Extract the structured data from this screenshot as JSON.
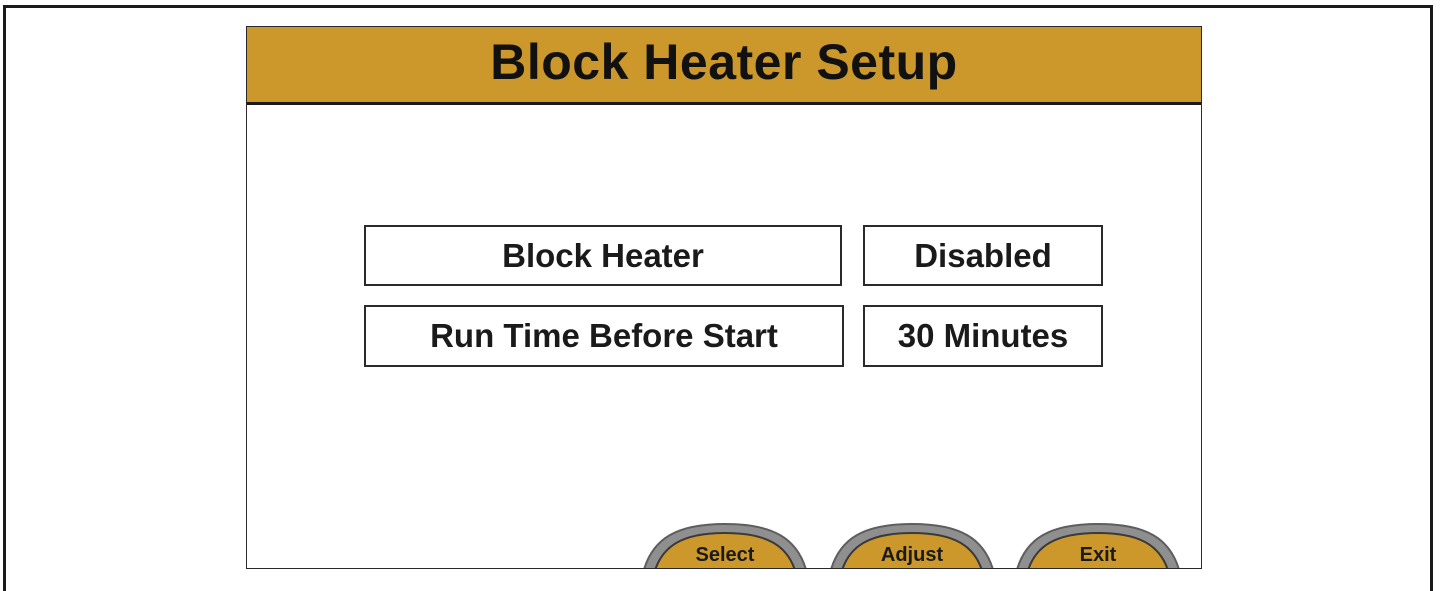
{
  "screen": {
    "title": "Block Heater Setup"
  },
  "settings": [
    {
      "label": "Block Heater",
      "value": "Disabled"
    },
    {
      "label": "Run Time Before Start",
      "value": "30 Minutes"
    }
  ],
  "softkeys": {
    "select": "Select",
    "adjust": "Adjust",
    "exit": "Exit"
  },
  "colors": {
    "title_bar": "#cc982b",
    "button_fill": "#cc982b",
    "button_rim": "#9a9a9a",
    "border": "#1a1a1a"
  }
}
